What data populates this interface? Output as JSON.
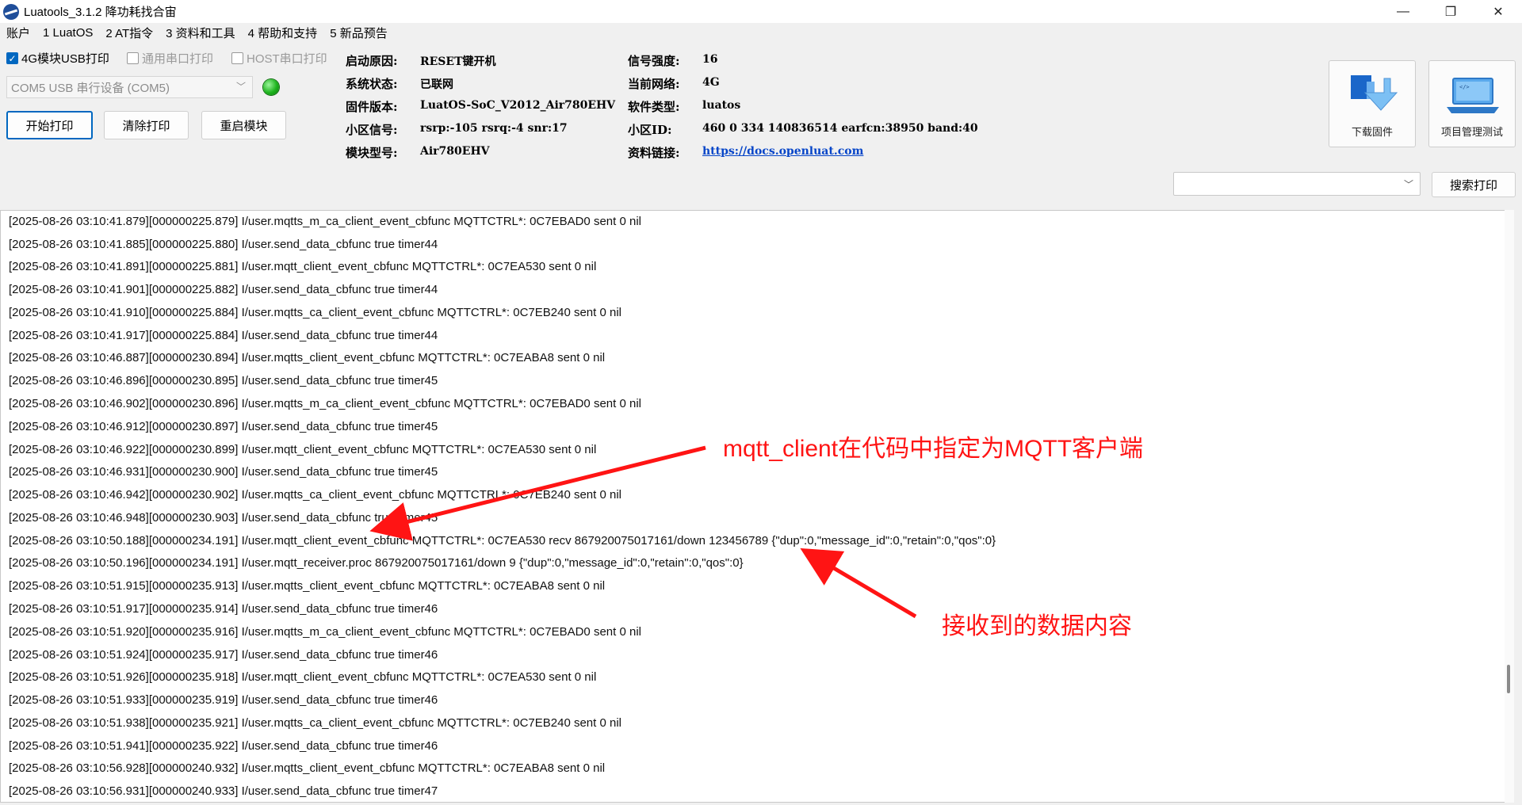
{
  "window": {
    "title": "Luatools_3.1.2 降功耗找合宙",
    "minimize_glyph": "—",
    "maximize_glyph": "❐",
    "close_glyph": "✕"
  },
  "menu": [
    "账户",
    "1 LuatOS",
    "2 AT指令",
    "3 资料和工具",
    "4 帮助和支持",
    "5 新品预告"
  ],
  "options": {
    "usb_print": {
      "label": "4G模块USB打印",
      "checked": true
    },
    "serial_print": {
      "label": "通用串口打印",
      "checked": false
    },
    "host_print": {
      "label": "HOST串口打印",
      "checked": false
    }
  },
  "port_select": {
    "value": "COM5 USB 串行设备 (COM5)"
  },
  "buttons": {
    "start_print": "开始打印",
    "clear_print": "清除打印",
    "restart_module": "重启模块",
    "search_print": "搜索打印"
  },
  "device_info": {
    "boot_reason": {
      "label": "启动原因:",
      "value": "RESET键开机"
    },
    "system_status": {
      "label": "系统状态:",
      "value": "已联网"
    },
    "firmware": {
      "label": "固件版本:",
      "value": "LuatOS-SoC_V2012_Air780EHV"
    },
    "cell_signal": {
      "label": "小区信号:",
      "value": "rsrp:-105 rsrq:-4 snr:17"
    },
    "module_model": {
      "label": "模块型号:",
      "value": "Air780EHV"
    },
    "signal_strength": {
      "label": "信号强度:",
      "value": "16"
    },
    "current_network": {
      "label": "当前网络:",
      "value": "4G"
    },
    "software_type": {
      "label": "软件类型:",
      "value": "luatos"
    },
    "cell_id": {
      "label": "小区ID:",
      "value": "460 0 334 140836514 earfcn:38950 band:40"
    },
    "docs_link": {
      "label": "资料链接:",
      "value": "https://docs.openluat.com"
    }
  },
  "tools": {
    "download_firmware": "下载固件",
    "project_test": "项目管理测试"
  },
  "log_lines": [
    "[2025-08-26 03:10:41.879][000000225.879] I/user.mqtts_m_ca_client_event_cbfunc MQTTCTRL*: 0C7EBAD0 sent 0 nil",
    "[2025-08-26 03:10:41.885][000000225.880] I/user.send_data_cbfunc true timer44",
    "[2025-08-26 03:10:41.891][000000225.881] I/user.mqtt_client_event_cbfunc MQTTCTRL*: 0C7EA530 sent 0 nil",
    "[2025-08-26 03:10:41.901][000000225.882] I/user.send_data_cbfunc true timer44",
    "[2025-08-26 03:10:41.910][000000225.884] I/user.mqtts_ca_client_event_cbfunc MQTTCTRL*: 0C7EB240 sent 0 nil",
    "[2025-08-26 03:10:41.917][000000225.884] I/user.send_data_cbfunc true timer44",
    "[2025-08-26 03:10:46.887][000000230.894] I/user.mqtts_client_event_cbfunc MQTTCTRL*: 0C7EABA8 sent 0 nil",
    "[2025-08-26 03:10:46.896][000000230.895] I/user.send_data_cbfunc true timer45",
    "[2025-08-26 03:10:46.902][000000230.896] I/user.mqtts_m_ca_client_event_cbfunc MQTTCTRL*: 0C7EBAD0 sent 0 nil",
    "[2025-08-26 03:10:46.912][000000230.897] I/user.send_data_cbfunc true timer45",
    "[2025-08-26 03:10:46.922][000000230.899] I/user.mqtt_client_event_cbfunc MQTTCTRL*: 0C7EA530 sent 0 nil",
    "[2025-08-26 03:10:46.931][000000230.900] I/user.send_data_cbfunc true timer45",
    "[2025-08-26 03:10:46.942][000000230.902] I/user.mqtts_ca_client_event_cbfunc MQTTCTRL*: 0C7EB240 sent 0 nil",
    "[2025-08-26 03:10:46.948][000000230.903] I/user.send_data_cbfunc true timer45",
    "[2025-08-26 03:10:50.188][000000234.191] I/user.mqtt_client_event_cbfunc MQTTCTRL*: 0C7EA530 recv 867920075017161/down 123456789 {\"dup\":0,\"message_id\":0,\"retain\":0,\"qos\":0}",
    "[2025-08-26 03:10:50.196][000000234.191] I/user.mqtt_receiver.proc 867920075017161/down 9 {\"dup\":0,\"message_id\":0,\"retain\":0,\"qos\":0}",
    "[2025-08-26 03:10:51.915][000000235.913] I/user.mqtts_client_event_cbfunc MQTTCTRL*: 0C7EABA8 sent 0 nil",
    "[2025-08-26 03:10:51.917][000000235.914] I/user.send_data_cbfunc true timer46",
    "[2025-08-26 03:10:51.920][000000235.916] I/user.mqtts_m_ca_client_event_cbfunc MQTTCTRL*: 0C7EBAD0 sent 0 nil",
    "[2025-08-26 03:10:51.924][000000235.917] I/user.send_data_cbfunc true timer46",
    "[2025-08-26 03:10:51.926][000000235.918] I/user.mqtt_client_event_cbfunc MQTTCTRL*: 0C7EA530 sent 0 nil",
    "[2025-08-26 03:10:51.933][000000235.919] I/user.send_data_cbfunc true timer46",
    "[2025-08-26 03:10:51.938][000000235.921] I/user.mqtts_ca_client_event_cbfunc MQTTCTRL*: 0C7EB240 sent 0 nil",
    "[2025-08-26 03:10:51.941][000000235.922] I/user.send_data_cbfunc true timer46",
    "[2025-08-26 03:10:56.928][000000240.932] I/user.mqtts_client_event_cbfunc MQTTCTRL*: 0C7EABA8 sent 0 nil",
    "[2025-08-26 03:10:56.931][000000240.933] I/user.send_data_cbfunc true timer47"
  ],
  "annotations": {
    "client_note": "mqtt_client在代码中指定为MQTT客户端",
    "data_note": "接收到的数据内容",
    "color": "#ff1414"
  },
  "colors": {
    "accent": "#0067c0",
    "status_led": "#1db31d",
    "link": "#0645c8"
  }
}
